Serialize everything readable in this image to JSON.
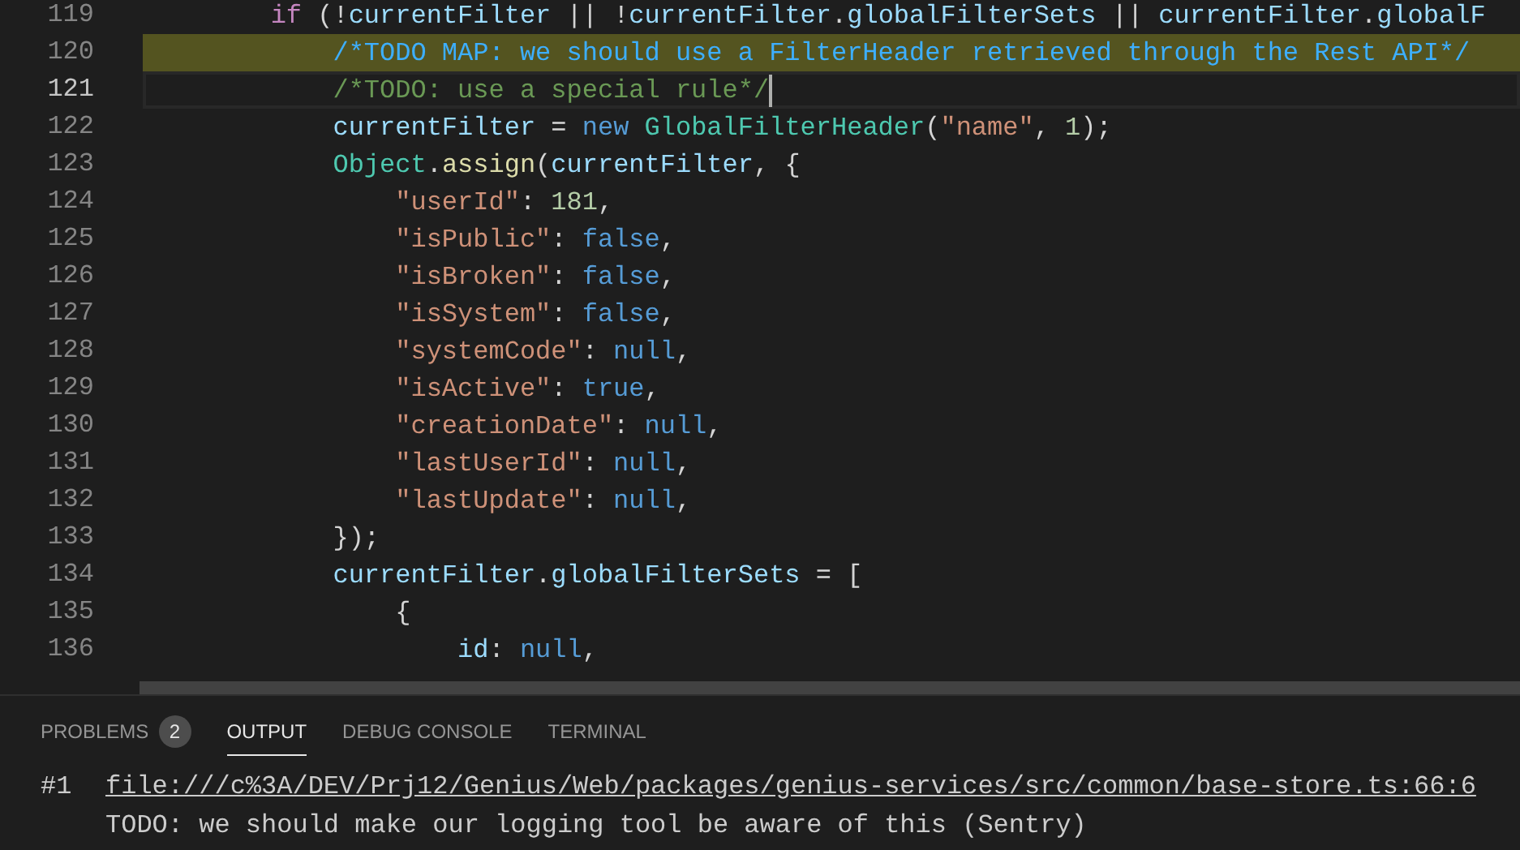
{
  "editor": {
    "lines": [
      {
        "number": "119",
        "highlighted": false,
        "current": false,
        "tokens": [
          {
            "kind": "keyword",
            "text": "        if"
          },
          {
            "kind": "plain",
            "text": " (!"
          },
          {
            "kind": "variable",
            "text": "currentFilter"
          },
          {
            "kind": "plain",
            "text": " || !"
          },
          {
            "kind": "variable",
            "text": "currentFilter"
          },
          {
            "kind": "plain",
            "text": "."
          },
          {
            "kind": "variable",
            "text": "globalFilterSets"
          },
          {
            "kind": "plain",
            "text": " || "
          },
          {
            "kind": "variable",
            "text": "currentFilter"
          },
          {
            "kind": "plain",
            "text": "."
          },
          {
            "kind": "variable",
            "text": "globalF"
          }
        ]
      },
      {
        "number": "120",
        "highlighted": true,
        "current": false,
        "tokens": [
          {
            "kind": "todo",
            "text": "            /*TODO MAP: we should use a FilterHeader retrieved through the Rest API*/"
          }
        ]
      },
      {
        "number": "121",
        "highlighted": false,
        "current": true,
        "tokens": [
          {
            "kind": "comment",
            "text": "            /*TODO: use a special rule*/"
          }
        ]
      },
      {
        "number": "122",
        "highlighted": false,
        "current": false,
        "tokens": [
          {
            "kind": "variable",
            "text": "            currentFilter"
          },
          {
            "kind": "plain",
            "text": " = "
          },
          {
            "kind": "constant",
            "text": "new"
          },
          {
            "kind": "class",
            "text": " GlobalFilterHeader"
          },
          {
            "kind": "plain",
            "text": "("
          },
          {
            "kind": "string",
            "text": "\"name\""
          },
          {
            "kind": "plain",
            "text": ", "
          },
          {
            "kind": "number",
            "text": "1"
          },
          {
            "kind": "plain",
            "text": ");"
          }
        ]
      },
      {
        "number": "123",
        "highlighted": false,
        "current": false,
        "tokens": [
          {
            "kind": "class",
            "text": "            Object"
          },
          {
            "kind": "plain",
            "text": "."
          },
          {
            "kind": "function",
            "text": "assign"
          },
          {
            "kind": "plain",
            "text": "("
          },
          {
            "kind": "variable",
            "text": "currentFilter"
          },
          {
            "kind": "plain",
            "text": ", {"
          }
        ]
      },
      {
        "number": "124",
        "highlighted": false,
        "current": false,
        "tokens": [
          {
            "kind": "string",
            "text": "                \"userId\""
          },
          {
            "kind": "plain",
            "text": ": "
          },
          {
            "kind": "number",
            "text": "181"
          },
          {
            "kind": "plain",
            "text": ","
          }
        ]
      },
      {
        "number": "125",
        "highlighted": false,
        "current": false,
        "tokens": [
          {
            "kind": "string",
            "text": "                \"isPublic\""
          },
          {
            "kind": "plain",
            "text": ": "
          },
          {
            "kind": "constant",
            "text": "false"
          },
          {
            "kind": "plain",
            "text": ","
          }
        ]
      },
      {
        "number": "126",
        "highlighted": false,
        "current": false,
        "tokens": [
          {
            "kind": "string",
            "text": "                \"isBroken\""
          },
          {
            "kind": "plain",
            "text": ": "
          },
          {
            "kind": "constant",
            "text": "false"
          },
          {
            "kind": "plain",
            "text": ","
          }
        ]
      },
      {
        "number": "127",
        "highlighted": false,
        "current": false,
        "tokens": [
          {
            "kind": "string",
            "text": "                \"isSystem\""
          },
          {
            "kind": "plain",
            "text": ": "
          },
          {
            "kind": "constant",
            "text": "false"
          },
          {
            "kind": "plain",
            "text": ","
          }
        ]
      },
      {
        "number": "128",
        "highlighted": false,
        "current": false,
        "tokens": [
          {
            "kind": "string",
            "text": "                \"systemCode\""
          },
          {
            "kind": "plain",
            "text": ": "
          },
          {
            "kind": "constant",
            "text": "null"
          },
          {
            "kind": "plain",
            "text": ","
          }
        ]
      },
      {
        "number": "129",
        "highlighted": false,
        "current": false,
        "tokens": [
          {
            "kind": "string",
            "text": "                \"isActive\""
          },
          {
            "kind": "plain",
            "text": ": "
          },
          {
            "kind": "constant",
            "text": "true"
          },
          {
            "kind": "plain",
            "text": ","
          }
        ]
      },
      {
        "number": "130",
        "highlighted": false,
        "current": false,
        "tokens": [
          {
            "kind": "string",
            "text": "                \"creationDate\""
          },
          {
            "kind": "plain",
            "text": ": "
          },
          {
            "kind": "constant",
            "text": "null"
          },
          {
            "kind": "plain",
            "text": ","
          }
        ]
      },
      {
        "number": "131",
        "highlighted": false,
        "current": false,
        "tokens": [
          {
            "kind": "string",
            "text": "                \"lastUserId\""
          },
          {
            "kind": "plain",
            "text": ": "
          },
          {
            "kind": "constant",
            "text": "null"
          },
          {
            "kind": "plain",
            "text": ","
          }
        ]
      },
      {
        "number": "132",
        "highlighted": false,
        "current": false,
        "tokens": [
          {
            "kind": "string",
            "text": "                \"lastUpdate\""
          },
          {
            "kind": "plain",
            "text": ": "
          },
          {
            "kind": "constant",
            "text": "null"
          },
          {
            "kind": "plain",
            "text": ","
          }
        ]
      },
      {
        "number": "133",
        "highlighted": false,
        "current": false,
        "tokens": [
          {
            "kind": "plain",
            "text": "            });"
          }
        ]
      },
      {
        "number": "134",
        "highlighted": false,
        "current": false,
        "tokens": [
          {
            "kind": "variable",
            "text": "            currentFilter"
          },
          {
            "kind": "plain",
            "text": "."
          },
          {
            "kind": "variable",
            "text": "globalFilterSets"
          },
          {
            "kind": "plain",
            "text": " = ["
          }
        ]
      },
      {
        "number": "135",
        "highlighted": false,
        "current": false,
        "tokens": [
          {
            "kind": "plain",
            "text": "                {"
          }
        ]
      },
      {
        "number": "136",
        "highlighted": false,
        "current": false,
        "tokens": [
          {
            "kind": "variable",
            "text": "                    id"
          },
          {
            "kind": "plain",
            "text": ": "
          },
          {
            "kind": "constant",
            "text": "null"
          },
          {
            "kind": "plain",
            "text": ","
          }
        ]
      }
    ]
  },
  "panel": {
    "tabs": [
      {
        "label": "PROBLEMS",
        "badge": "2",
        "selected": false
      },
      {
        "label": "OUTPUT",
        "selected": true
      },
      {
        "label": "DEBUG CONSOLE",
        "selected": false
      },
      {
        "label": "TERMINAL",
        "selected": false
      }
    ],
    "output": {
      "index": "#1",
      "link": "file:///c%3A/DEV/Prj12/Genius/Web/packages/genius-services/src/common/base-store.ts:66:6",
      "message": "TODO: we should make our logging tool be aware of this (Sentry)"
    }
  }
}
